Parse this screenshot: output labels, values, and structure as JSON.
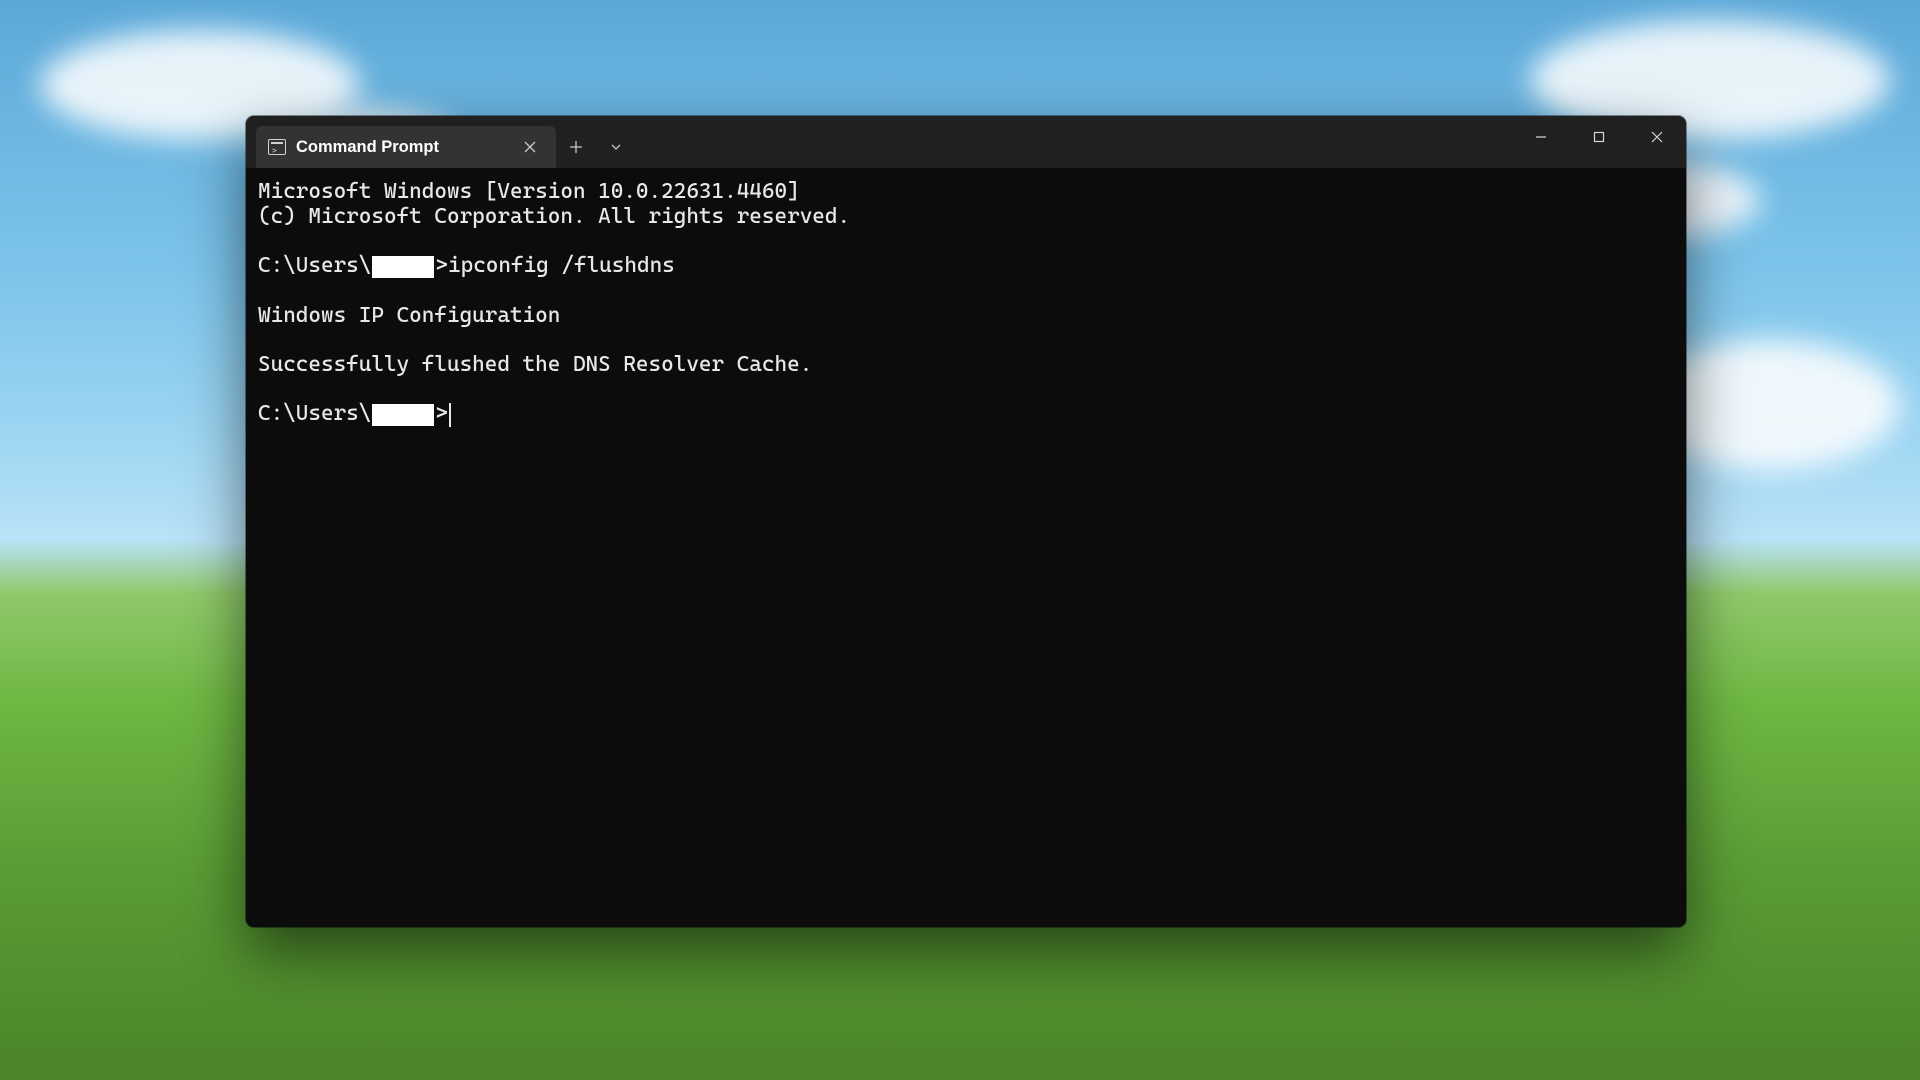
{
  "tab": {
    "title": "Command Prompt"
  },
  "terminal": {
    "banner1": "Microsoft Windows [Version 10.0.22631.4460]",
    "banner2": "(c) Microsoft Corporation. All rights reserved.",
    "prompt_prefix": "C:\\Users\\",
    "prompt_suffix": ">",
    "command1": "ipconfig /flushdns",
    "out1": "Windows IP Configuration",
    "out2": "Successfully flushed the DNS Resolver Cache."
  }
}
